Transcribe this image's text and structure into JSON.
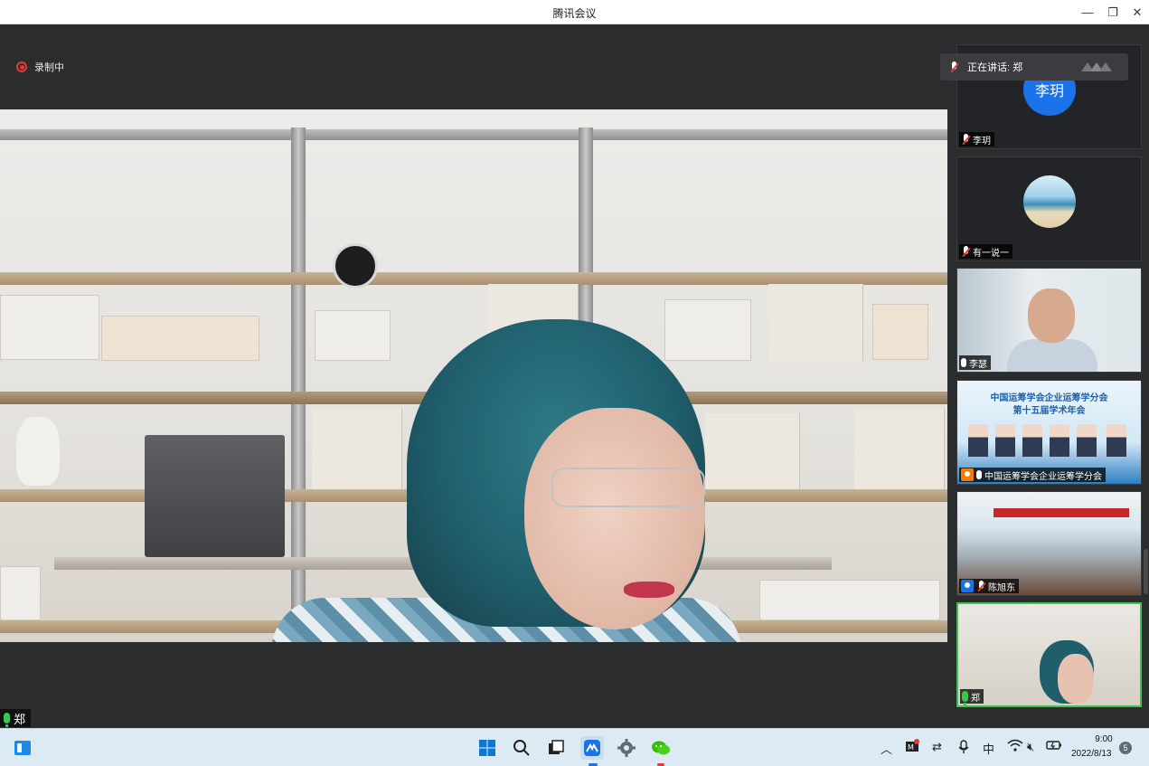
{
  "window": {
    "title": "腾讯会议",
    "minimize_glyph": "—",
    "restore_glyph": "❐",
    "close_glyph": "✕"
  },
  "stage": {
    "recording_label": "录制中",
    "speaker_name": "郑"
  },
  "panel": {
    "speaking_label": "正在讲话: 郑",
    "participants": [
      {
        "name": "李玥",
        "avatar_text": "李玥",
        "avatar_color": "#1a73e8",
        "mic": "muted"
      },
      {
        "name": "有一说一",
        "mic": "muted"
      },
      {
        "name": "李瑟",
        "mic": "on"
      },
      {
        "name": "中国运筹学会企业运筹学分会",
        "mic": "on",
        "role": "host",
        "poster_title_1": "中国运筹学会企业运筹学分会",
        "poster_title_2": "第十五届学术年会"
      },
      {
        "name": "陈旭东",
        "mic": "muted",
        "role": "user"
      },
      {
        "name": "郑",
        "mic": "on",
        "active": true
      }
    ]
  },
  "taskbar": {
    "icons": [
      "windows-start-icon",
      "search-icon",
      "task-view-icon",
      "tencent-meeting-icon",
      "settings-icon",
      "wechat-icon"
    ],
    "tray": {
      "ime": "中",
      "time": "9:00",
      "date": "2022/8/13",
      "notifications": "5"
    }
  },
  "colors": {
    "accent_green": "#3ec44e",
    "record_red": "#e53935",
    "avatar_blue": "#1a73e8"
  }
}
